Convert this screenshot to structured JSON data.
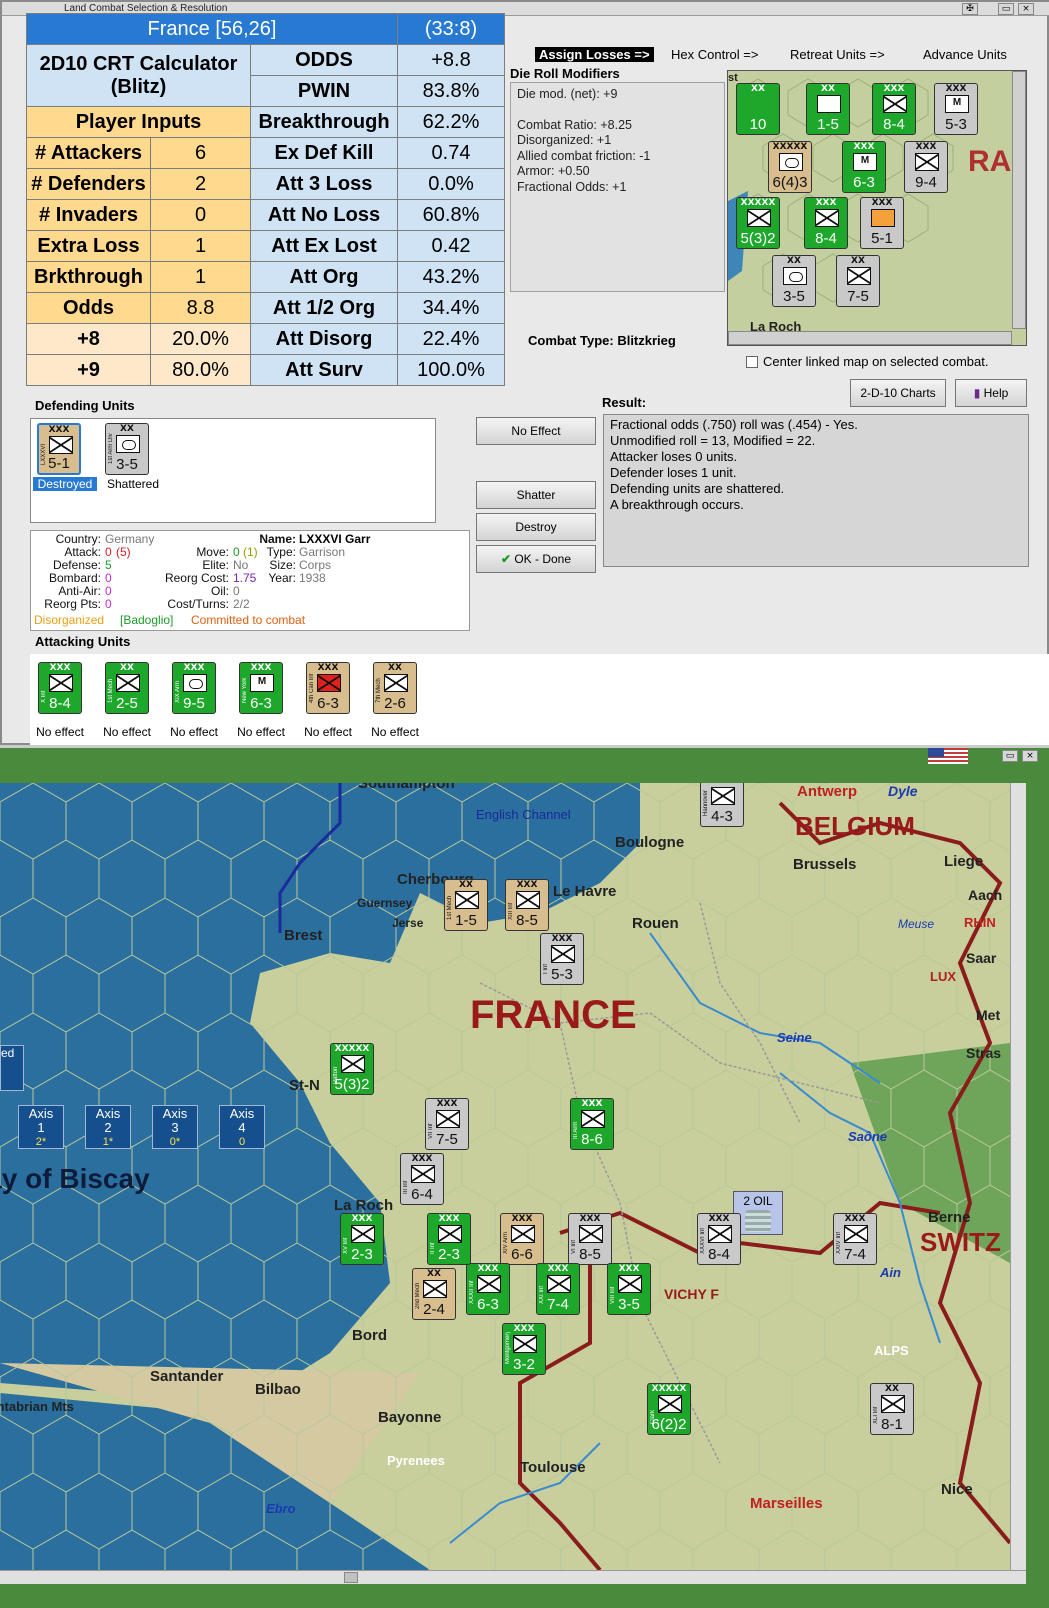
{
  "window": {
    "title": "Land Combat Selection & Resolution"
  },
  "calc": {
    "title": "France [56,26]",
    "coords": "(33:8)",
    "calc_line1": "2D10 CRT Calculator",
    "calc_line2": "(Blitz)",
    "player_inputs": "Player Inputs",
    "rows_left": [
      {
        "label": "# Attackers",
        "value": "6"
      },
      {
        "label": "# Defenders",
        "value": "2"
      },
      {
        "label": "# Invaders",
        "value": "0"
      },
      {
        "label": "Extra Loss",
        "value": "1"
      },
      {
        "label": "Brkthrough",
        "value": "1"
      },
      {
        "label": "Odds",
        "value": "8.8"
      },
      {
        "label": "+8",
        "value": "20.0%"
      },
      {
        "label": "+9",
        "value": "80.0%"
      }
    ],
    "rows_right": [
      {
        "label": "ODDS",
        "value": "+8.8"
      },
      {
        "label": "PWIN",
        "value": "83.8%"
      },
      {
        "label": "Breakthrough",
        "value": "62.2%"
      },
      {
        "label": "Ex Def Kill",
        "value": "0.74"
      },
      {
        "label": "Att 3 Loss",
        "value": "0.0%"
      },
      {
        "label": "Att No Loss",
        "value": "60.8%"
      },
      {
        "label": "Att Ex Lost",
        "value": "0.42"
      },
      {
        "label": "Att Org",
        "value": "43.2%"
      },
      {
        "label": "Att 1/2 Org",
        "value": "34.4%"
      },
      {
        "label": "Att Disorg",
        "value": "22.4%"
      },
      {
        "label": "Att Surv",
        "value": "100.0%"
      }
    ]
  },
  "steps": {
    "assign": "Assign Losses =>",
    "hex": "Hex Control =>",
    "retreat": "Retreat Units =>",
    "advance": "Advance Units"
  },
  "die": {
    "title": "Die Roll Modifiers",
    "lines": [
      "Die mod. (net): +9",
      "",
      "Combat Ratio: +8.25",
      "Disorganized: +1",
      "Allied combat friction: -1",
      "Armor: +0.50",
      "Fractional Odds: +1"
    ],
    "combat_type": "Combat Type:  Blitzkrieg"
  },
  "center_map": "Center linked map on selected combat.",
  "buttons": {
    "charts": "2-D-10 Charts",
    "help": "Help",
    "no_effect": "No Effect",
    "shatter": "Shatter",
    "destroy": "Destroy",
    "ok": "OK - Done"
  },
  "defending": {
    "title": "Defending Units",
    "units": [
      {
        "name": "LXXXVI Garr",
        "size": "XXX",
        "str": "5-1",
        "status": "Destroyed"
      },
      {
        "name": "1st Arm Div",
        "size": "XX",
        "str": "3-5",
        "status": "Shattered"
      }
    ]
  },
  "result": {
    "title": "Result:",
    "lines": [
      "Fractional odds (.750) roll was (.454)  - Yes.",
      "Unmodified roll = 13, Modified = 22.",
      "Attacker loses 0 units.",
      "Defender loses 1 unit.",
      "Defending units are shattered.",
      "A breakthrough occurs."
    ]
  },
  "info": {
    "country_l": "Country:",
    "country": "Germany",
    "attack_l": "Attack:",
    "attack": "0",
    "attack2": "(5)",
    "defense_l": "Defense:",
    "defense": "5",
    "bombard_l": "Bombard:",
    "bombard": "0",
    "antiair_l": "Anti-Air:",
    "antiair": "0",
    "reorg_l": "Reorg Pts:",
    "reorg": "0",
    "move_l": "Move:",
    "move": "0",
    "move2": "(1)",
    "elite_l": "Elite:",
    "elite": "No",
    "rcost_l": "Reorg Cost:",
    "rcost": "1.75",
    "oil_l": "Oil:",
    "oil": "0",
    "cost_l": "Cost/Turns:",
    "cost": "2/2",
    "name_l": "Name:",
    "name": "LXXXVI Garr",
    "type_l": "Type:",
    "type": "Garrison",
    "size_l": "Size:",
    "size": "Corps",
    "year_l": "Year:",
    "year": "1938",
    "status1": "Disorganized",
    "status2": "[Badoglio]",
    "status3": "Committed to combat"
  },
  "attacking": {
    "title": "Attacking Units",
    "units": [
      {
        "name": "X Inf",
        "size": "XXX",
        "str": "8-4",
        "status": "No effect"
      },
      {
        "name": "1st Mech Div",
        "size": "XX",
        "str": "2-5",
        "status": "No effect"
      },
      {
        "name": "XIX Arm",
        "size": "XXX",
        "str": "9-5",
        "status": "No effect"
      },
      {
        "name": "New York",
        "size": "XXX",
        "str": "6-3",
        "status": "No effect"
      },
      {
        "name": "4th Can Inf",
        "size": "XXX",
        "str": "6-3",
        "status": "No effect"
      },
      {
        "name": "7th Mech Div",
        "size": "XX",
        "str": "2-6",
        "status": "No effect"
      }
    ]
  },
  "map": {
    "labels": {
      "southampton": "Southampton",
      "channel": "English Channel",
      "boulogne": "Boulogne",
      "antwerp": "Antwerp",
      "dyle": "Dyle",
      "belgium": "BELGIUM",
      "brussels": "Brussels",
      "liege": "Liege",
      "cherbourg": "Cherbourg",
      "lehavre": "Le Havre",
      "guernsey": "Guernsey",
      "jersey": "Jerse",
      "rouen": "Rouen",
      "brest": "Brest",
      "meuse": "Meuse",
      "lux": "LUX",
      "seine": "Seine",
      "france": "FRANCE",
      "biscay": "Bay of Biscay",
      "stn": "St-N",
      "larochelle": "La Roch",
      "bordeaux": "Bord",
      "saone": "Saône",
      "berne": "Berne",
      "switz": "SWITZ",
      "vichy": "VICHY F",
      "ain": "Ain",
      "alps": "ALPS",
      "santander": "Santander",
      "bilbao": "Bilbao",
      "cantabrian": "Cantabrian Mts",
      "bayonne": "Bayonne",
      "pyrenees": "Pyrenees",
      "toulouse": "Toulouse",
      "ebro": "Ebro",
      "marseilles": "Marseilles",
      "nice": "Nice",
      "rhine": "RHIN",
      "aach": "Aach",
      "saar": "Saar",
      "metz": "Met",
      "stras": "Stras",
      "oil": "2 OIL",
      "allied": "Allied"
    },
    "axis_boxes": [
      {
        "n": "1",
        "sub": "2*"
      },
      {
        "n": "2",
        "sub": "1*"
      },
      {
        "n": "3",
        "sub": "0*"
      },
      {
        "n": "4",
        "sub": "0"
      }
    ],
    "axis_label": "Axis",
    "map_units": [
      {
        "name": "Hannover Garr",
        "size": "XXX",
        "str": "4-3",
        "cls": "gy"
      },
      {
        "name": "1st Mech Div",
        "size": "XX",
        "str": "1-5",
        "cls": "tn"
      },
      {
        "name": "XIII Inf",
        "size": "XXX",
        "str": "8-5",
        "cls": "tn"
      },
      {
        "name": "I Inf",
        "size": "XXX",
        "str": "5-3",
        "cls": "gy"
      },
      {
        "name": "III Inf",
        "size": "XXX",
        "str": "6-4",
        "cls": "gy"
      },
      {
        "name": "VII Inf",
        "size": "XXX",
        "str": "7-5",
        "cls": "gy"
      },
      {
        "name": "2nd Mech",
        "size": "XX",
        "str": "2-4",
        "cls": "tn"
      },
      {
        "name": "XIV Arm",
        "size": "XXX",
        "str": "6-6",
        "cls": "tn"
      },
      {
        "name": "VI Inf",
        "size": "XXX",
        "str": "8-5",
        "cls": "gy"
      },
      {
        "name": "XXXVI Inf",
        "size": "XXX",
        "str": "8-4",
        "cls": "gy"
      },
      {
        "name": "XXIV Inf",
        "size": "XXX",
        "str": "7-4",
        "cls": "gy"
      },
      {
        "name": "XLI Inf",
        "size": "XX",
        "str": "8-1",
        "cls": "gy"
      },
      {
        "name": "XXI Inf",
        "size": "XXX",
        "str": "7-4",
        "cls": "gr"
      },
      {
        "name": "XXXII Inf",
        "size": "XXX",
        "str": "6-3",
        "cls": "gr"
      },
      {
        "name": "VIII Inf",
        "size": "XXX",
        "str": "3-5",
        "cls": "gr"
      },
      {
        "name": "II Inf",
        "size": "XXX",
        "str": "2-3",
        "cls": "gr"
      },
      {
        "name": "XV Inf",
        "size": "XXX",
        "str": "2-3",
        "cls": "gr"
      },
      {
        "name": "III Arm",
        "size": "XXX",
        "str": "8-6",
        "cls": "gr"
      },
      {
        "name": "Montgomery",
        "size": "XXX",
        "str": "3-2",
        "cls": "gr"
      },
      {
        "name": "Clark",
        "size": "XXXXX",
        "str": "6(2)2",
        "cls": "gr"
      },
      {
        "name": "Patton",
        "size": "XXXXX",
        "str": "5(3)2",
        "cls": "gr"
      }
    ]
  }
}
